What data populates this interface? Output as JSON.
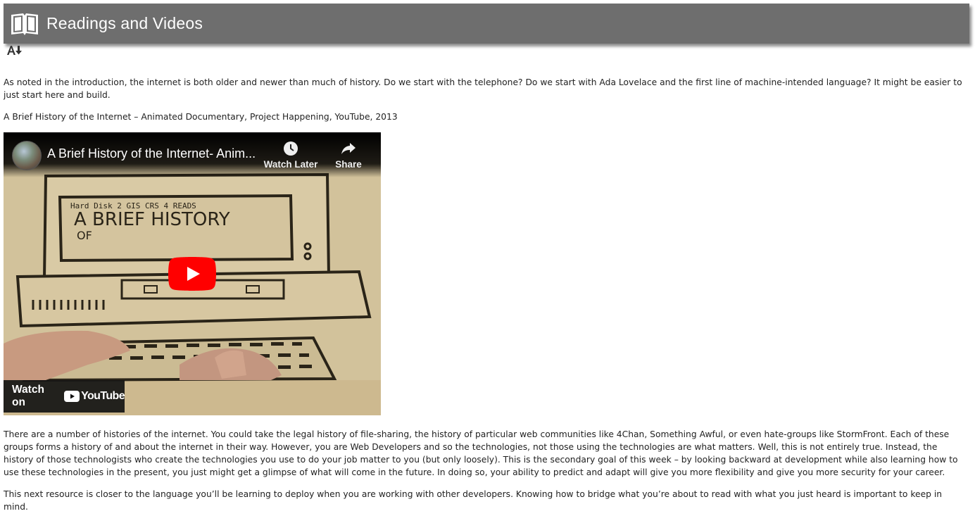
{
  "header": {
    "title": "Readings and Videos",
    "icon": "book-icon",
    "bg_color": "#6e6e6e"
  },
  "toolbar": {
    "accessibility_icon": "text-size-icon"
  },
  "content": {
    "intro": "As noted in the introduction, the internet is both older and newer than much of history. Do we start with the telephone? Do we start with Ada Lovelace and the first line of machine-intended language? It might be easier to just start here and build.",
    "citation": "A Brief History of the Internet – Animated Documentary, Project Happening, YouTube, 2013",
    "histories": "There are a number of histories of the internet. You could take the legal history of file-sharing, the history of particular web communities like 4Chan, Something Awful, or even hate-groups like StormFront. Each of these groups forms a history of and about the internet in their way. However, you are Web Developers and so the technologies, not those using the technologies are what matters. Well, this is not entirely true. Instead, the history of those technologists who create the technologies you use to do your job matter to you (but only loosely). This is the secondary goal of this week – by looking backward at development while also learning how to use these technologies in the present, you just might get a glimpse of what will come in the future. In doing so, your ability to predict and adapt will give you more flexibility and give you more security for your career.",
    "next_resource": "This next resource is closer to the language you’ll be learning to deploy when you are working with other developers. Knowing how to bridge what you’re about to read with what you just heard is important to keep in mind."
  },
  "video": {
    "title": "A Brief History of the Internet- Anim...",
    "watch_later_label": "Watch Later",
    "share_label": "Share",
    "watch_on_label": "Watch on",
    "youtube_label": "YouTube",
    "thumbnail_text_line1": "Hard Disk 2   GIS CRS 4 READS",
    "thumbnail_text_line2": "A BRIEF HISTORY",
    "thumbnail_text_line3": "OF",
    "play_color": "#ff0000"
  }
}
